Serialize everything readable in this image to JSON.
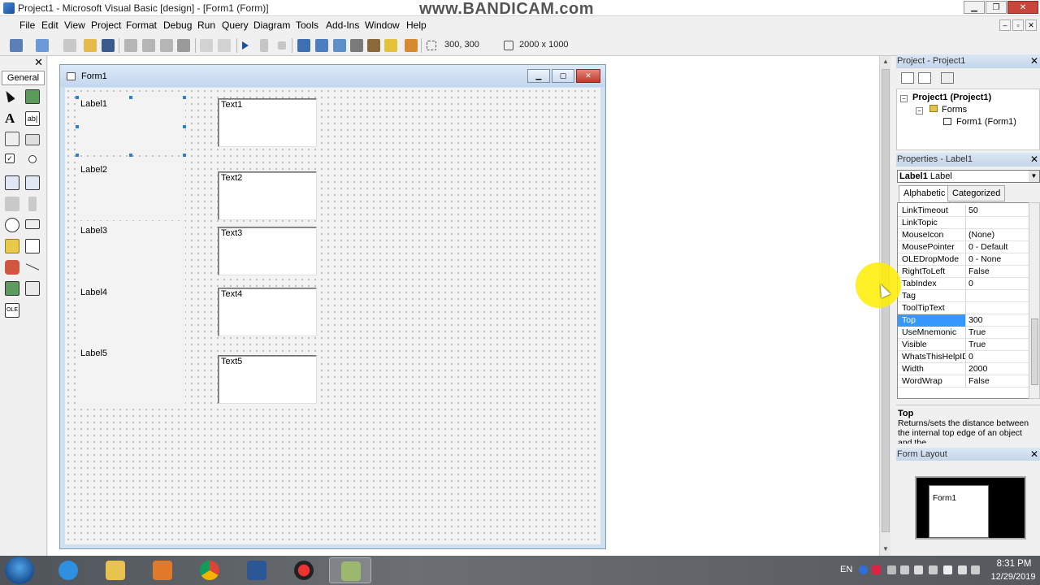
{
  "window": {
    "title": "Project1 - Microsoft Visual Basic [design] - [Form1 (Form)]",
    "watermark": "www.BANDICAM.com",
    "minimize": "▁",
    "restore": "❐",
    "close": "✕"
  },
  "menu": {
    "items": [
      "File",
      "Edit",
      "View",
      "Project",
      "Format",
      "Debug",
      "Run",
      "Query",
      "Diagram",
      "Tools",
      "Add-Ins",
      "Window",
      "Help"
    ],
    "mdi_min": "–",
    "mdi_restore": "▫",
    "mdi_close": "✕"
  },
  "toolbar": {
    "position": "300, 300",
    "size": "2000 x 1000"
  },
  "toolbox": {
    "close": "✕",
    "tab": "General"
  },
  "form": {
    "caption": "Form1",
    "min": "▁",
    "max": "▢",
    "close": "✕",
    "labels": [
      "Label1",
      "Label2",
      "Label3",
      "Label4",
      "Label5"
    ],
    "textboxes": [
      "Text1",
      "Text2",
      "Text3",
      "Text4",
      "Text5"
    ]
  },
  "project": {
    "header": "Project - Project1",
    "close": "✕",
    "root": "Project1 (Project1)",
    "folder": "Forms",
    "form": "Form1 (Form1)",
    "expand_sym": "−"
  },
  "properties": {
    "header": "Properties - Label1",
    "close": "✕",
    "object_name": "Label1",
    "object_type": "Label",
    "tab_alpha": "Alphabetic",
    "tab_cat": "Categorized",
    "rows": [
      {
        "name": "LinkTimeout",
        "value": "50"
      },
      {
        "name": "LinkTopic",
        "value": ""
      },
      {
        "name": "MouseIcon",
        "value": "(None)"
      },
      {
        "name": "MousePointer",
        "value": "0 - Default"
      },
      {
        "name": "OLEDropMode",
        "value": "0 - None"
      },
      {
        "name": "RightToLeft",
        "value": "False"
      },
      {
        "name": "TabIndex",
        "value": "0"
      },
      {
        "name": "Tag",
        "value": ""
      },
      {
        "name": "ToolTipText",
        "value": ""
      },
      {
        "name": "Top",
        "value": "300"
      },
      {
        "name": "UseMnemonic",
        "value": "True"
      },
      {
        "name": "Visible",
        "value": "True"
      },
      {
        "name": "WhatsThisHelpID",
        "value": "0"
      },
      {
        "name": "Width",
        "value": "2000"
      },
      {
        "name": "WordWrap",
        "value": "False"
      }
    ],
    "selected_index": 9,
    "desc_title": "Top",
    "desc_text": "Returns/sets the distance between the internal top edge of an object and the"
  },
  "layout": {
    "header": "Form Layout",
    "close": "✕",
    "form": "Form1"
  },
  "taskbar": {
    "lang": "EN",
    "time": "8:31 PM",
    "date": "12/29/2019"
  },
  "colors": {
    "selection": "#3399ff",
    "highlight": "#ffee00",
    "title_close": "#c9463d"
  }
}
